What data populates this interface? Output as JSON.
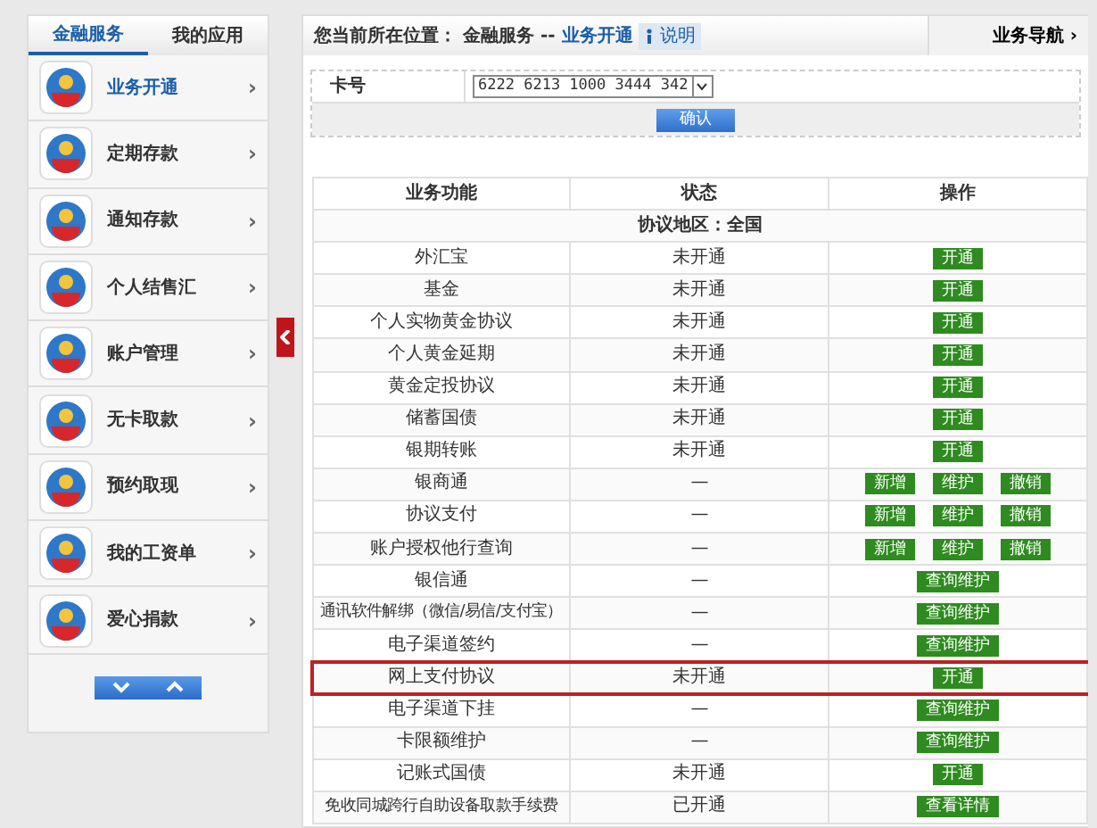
{
  "sidebar": {
    "tabs": [
      {
        "label": "金融服务",
        "selected": true
      },
      {
        "label": "我的应用",
        "selected": false
      }
    ],
    "items": [
      {
        "label": "业务开通",
        "selected": true
      },
      {
        "label": "定期存款",
        "selected": false
      },
      {
        "label": "通知存款",
        "selected": false
      },
      {
        "label": "个人结售汇",
        "selected": false
      },
      {
        "label": "账户管理",
        "selected": false
      },
      {
        "label": "无卡取款",
        "selected": false
      },
      {
        "label": "预约取现",
        "selected": false
      },
      {
        "label": "我的工资单",
        "selected": false
      },
      {
        "label": "爱心捐款",
        "selected": false
      }
    ],
    "chevron": "›"
  },
  "breadcrumb": {
    "prefix": "您当前所在位置：",
    "section": "金融服务",
    "separator": "--",
    "current": "业务开通",
    "help": "说明"
  },
  "nav_button": "业务导航 ›",
  "card": {
    "label": "卡号",
    "value": "6222 6213 1000 3444 342",
    "confirm": "确认"
  },
  "table": {
    "columns": [
      "业务功能",
      "状态",
      "操作"
    ],
    "region": "协议地区：全国",
    "rows": [
      {
        "name": "外汇宝",
        "status": "未开通",
        "actions": [
          "开通"
        ],
        "highlighted": false
      },
      {
        "name": "基金",
        "status": "未开通",
        "actions": [
          "开通"
        ],
        "highlighted": false
      },
      {
        "name": "个人实物黄金协议",
        "status": "未开通",
        "actions": [
          "开通"
        ],
        "highlighted": false
      },
      {
        "name": "个人黄金延期",
        "status": "未开通",
        "actions": [
          "开通"
        ],
        "highlighted": false
      },
      {
        "name": "黄金定投协议",
        "status": "未开通",
        "actions": [
          "开通"
        ],
        "highlighted": false
      },
      {
        "name": "储蓄国债",
        "status": "未开通",
        "actions": [
          "开通"
        ],
        "highlighted": false
      },
      {
        "name": "银期转账",
        "status": "未开通",
        "actions": [
          "开通"
        ],
        "highlighted": false
      },
      {
        "name": "银商通",
        "status": "—",
        "actions": [
          "新增",
          "维护",
          "撤销"
        ],
        "highlighted": false
      },
      {
        "name": "协议支付",
        "status": "—",
        "actions": [
          "新增",
          "维护",
          "撤销"
        ],
        "highlighted": false
      },
      {
        "name": "账户授权他行查询",
        "status": "—",
        "actions": [
          "新增",
          "维护",
          "撤销"
        ],
        "highlighted": false
      },
      {
        "name": "银信通",
        "status": "—",
        "actions": [
          "查询维护"
        ],
        "highlighted": false
      },
      {
        "name": "通讯软件解绑（微信/易信/支付宝）",
        "status": "—",
        "actions": [
          "查询维护"
        ],
        "highlighted": false
      },
      {
        "name": "电子渠道签约",
        "status": "—",
        "actions": [
          "查询维护"
        ],
        "highlighted": false
      },
      {
        "name": "网上支付协议",
        "status": "未开通",
        "actions": [
          "开通"
        ],
        "highlighted": true
      },
      {
        "name": "电子渠道下挂",
        "status": "—",
        "actions": [
          "查询维护"
        ],
        "highlighted": false
      },
      {
        "name": "卡限额维护",
        "status": "—",
        "actions": [
          "查询维护"
        ],
        "highlighted": false
      },
      {
        "name": "记账式国债",
        "status": "未开通",
        "actions": [
          "开通"
        ],
        "highlighted": false
      },
      {
        "name": "免收同城跨行自助设备取款手续费",
        "status": "已开通",
        "actions": [
          "查看详情"
        ],
        "highlighted": false
      }
    ]
  }
}
